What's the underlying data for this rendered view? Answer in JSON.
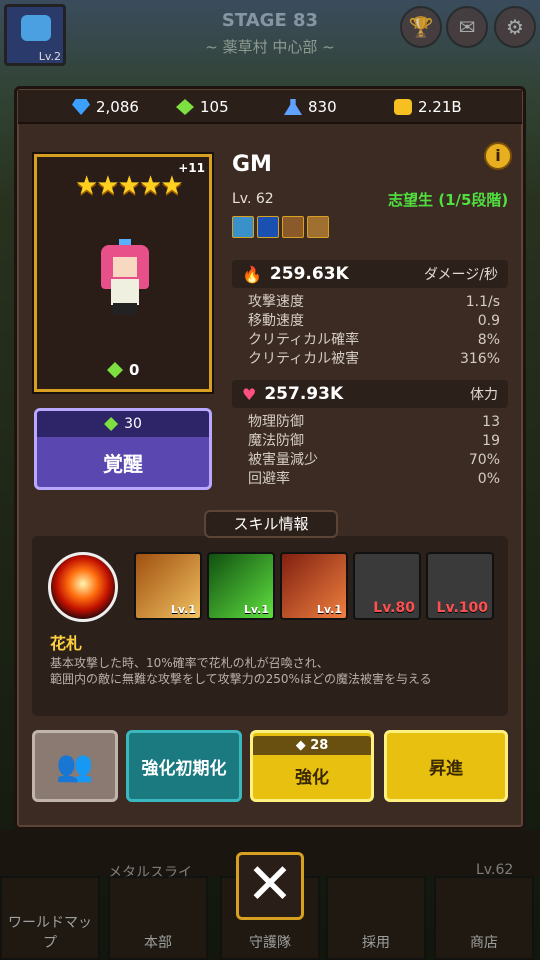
{
  "top": {
    "stage": "STAGE 83",
    "area": "~ 薬草村 中心部 ~",
    "avatar_level": "Lv.2"
  },
  "resources": {
    "gems": "2,086",
    "green_gems": "105",
    "potions": "830",
    "gold": "2.21B"
  },
  "hero": {
    "name": "GM",
    "level": "Lv. 62",
    "rank": "志望生 (1/5段階)",
    "stars": "★★★★★",
    "plus": "+11",
    "gem_count": "0"
  },
  "awaken": {
    "cost": "30",
    "label": "覚醒"
  },
  "attack": {
    "value": "259.63K",
    "label": "ダメージ/秒"
  },
  "attack_stats": [
    {
      "k": "攻撃速度",
      "v": "1.1/s"
    },
    {
      "k": "移動速度",
      "v": "0.9"
    },
    {
      "k": "クリティカル確率",
      "v": "8%"
    },
    {
      "k": "クリティカル被害",
      "v": "316%"
    }
  ],
  "hp": {
    "value": "257.93K",
    "label": "体力"
  },
  "defense_stats": [
    {
      "k": "物理防御",
      "v": "13"
    },
    {
      "k": "魔法防御",
      "v": "19"
    },
    {
      "k": "被害量減少",
      "v": "70%"
    },
    {
      "k": "回避率",
      "v": "0%"
    }
  ],
  "skill": {
    "header": "スキル情報",
    "name": "花札",
    "desc1": "基本攻撃した時、10%確率で花札の札が召喚され、",
    "desc2": "範囲内の敵に無難な攻撃をして攻撃力の250%ほどの魔法被害を与える",
    "slots": [
      {
        "level": "Lv.1"
      },
      {
        "level": "Lv.1"
      },
      {
        "level": "Lv.1"
      },
      {
        "level": "Lv.80"
      },
      {
        "level": "Lv.100"
      }
    ]
  },
  "buttons": {
    "reset": "強化初期化",
    "upgrade_cost": "28",
    "upgrade": "強化",
    "promote": "昇進"
  },
  "nav": [
    "ワールドマップ",
    "本部",
    "守護隊",
    "採用",
    "商店"
  ],
  "bg_text": {
    "medal": "メタルスライ",
    "lv": "Lv.62"
  },
  "colors": {
    "accent": "#d8a020",
    "rank": "#50e040",
    "awaken": "#5a48b0",
    "upgrade": "#e8c010",
    "reset": "#1a7a80"
  }
}
